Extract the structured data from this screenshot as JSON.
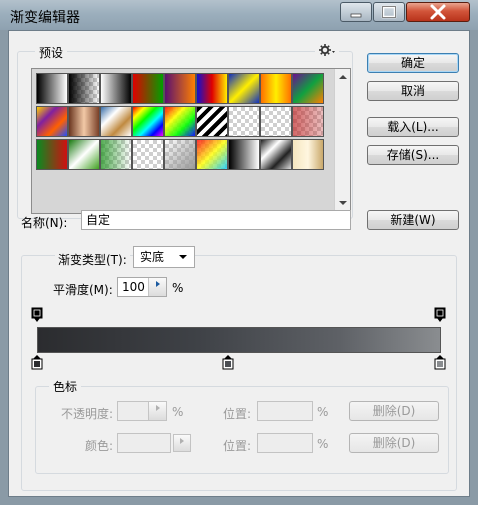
{
  "window": {
    "title": "渐变编辑器"
  },
  "presets": {
    "label": "预设",
    "menu_icon": "gear-icon",
    "swatches": [
      {
        "name": "swatch-black-white"
      },
      {
        "name": "swatch-black-transparent"
      },
      {
        "name": "swatch-white-black"
      },
      {
        "name": "swatch-red-green"
      },
      {
        "name": "swatch-violet-orange"
      },
      {
        "name": "swatch-blue-red-yellow"
      },
      {
        "name": "swatch-blue-yellow-blue"
      },
      {
        "name": "swatch-orange-yellow-orange"
      },
      {
        "name": "swatch-violet-green-orange"
      },
      {
        "name": "swatch-yellow-violet-orange-blue"
      },
      {
        "name": "swatch-copper"
      },
      {
        "name": "swatch-chrome"
      },
      {
        "name": "swatch-spectrum"
      },
      {
        "name": "swatch-transparent-rainbow"
      },
      {
        "name": "swatch-transparent-stripes"
      },
      {
        "name": "swatch-checker-1"
      },
      {
        "name": "swatch-checker-2"
      },
      {
        "name": "swatch-checker-red"
      },
      {
        "name": "swatch-green-red"
      },
      {
        "name": "swatch-green-white"
      },
      {
        "name": "swatch-checker-green"
      },
      {
        "name": "swatch-checker-3"
      },
      {
        "name": "swatch-checker-4"
      },
      {
        "name": "swatch-transparent-rainbow-2"
      },
      {
        "name": "swatch-black-white-2"
      },
      {
        "name": "swatch-chrome-2"
      },
      {
        "name": "swatch-gold"
      }
    ]
  },
  "buttons": {
    "ok": "确定",
    "cancel": "取消",
    "load": "载入(L)...",
    "save": "存储(S)...",
    "new": "新建(W)",
    "delete1": "删除(D)",
    "delete2": "删除(D)"
  },
  "name_field": {
    "label": "名称(N):",
    "value": "自定"
  },
  "gradient": {
    "type_label": "渐变类型(T):",
    "type_value": "实底",
    "smooth_label": "平滑度(M):",
    "smooth_value": "100",
    "smooth_unit": "%"
  },
  "color_stops": {
    "label": "色标",
    "opacity_label": "不透明度:",
    "opacity_unit": "%",
    "opacity_location_label": "位置:",
    "opacity_location_unit": "%",
    "color_label": "颜色:",
    "color_location_label": "位置:",
    "color_location_unit": "%"
  }
}
